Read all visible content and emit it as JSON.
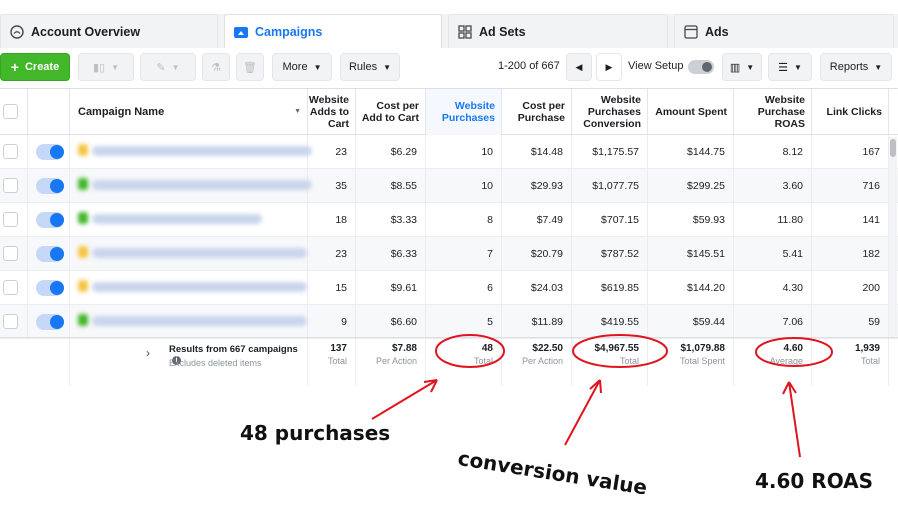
{
  "tabs": [
    {
      "label": "Account Overview",
      "icon": "gauge-icon"
    },
    {
      "label": "Campaigns",
      "icon": "folder-icon"
    },
    {
      "label": "Ad Sets",
      "icon": "grid-icon"
    },
    {
      "label": "Ads",
      "icon": "ad-icon"
    }
  ],
  "toolbar": {
    "create_label": "Create",
    "more_label": "More",
    "rules_label": "Rules",
    "pager_text": "1-200 of 667",
    "view_setup_label": "View Setup",
    "reports_label": "Reports"
  },
  "table": {
    "columns": [
      "Campaign Name",
      "Website Adds to Cart",
      "Cost per Add to Cart",
      "Website Purchases",
      "Cost per Purchase",
      "Website Purchases Conversion",
      "Amount Spent",
      "Website Purchase ROAS",
      "Link Clicks"
    ],
    "rows": [
      [
        "23",
        "$6.29",
        "10",
        "$14.48",
        "$1,175.57",
        "$144.75",
        "8.12",
        "167"
      ],
      [
        "35",
        "$8.55",
        "10",
        "$29.93",
        "$1,077.75",
        "$299.25",
        "3.60",
        "716"
      ],
      [
        "18",
        "$3.33",
        "8",
        "$7.49",
        "$707.15",
        "$59.93",
        "11.80",
        "141"
      ],
      [
        "23",
        "$6.33",
        "7",
        "$20.79",
        "$787.52",
        "$145.51",
        "5.41",
        "182"
      ],
      [
        "15",
        "$9.61",
        "6",
        "$24.03",
        "$619.85",
        "$144.20",
        "4.30",
        "200"
      ],
      [
        "9",
        "$6.60",
        "5",
        "$11.89",
        "$419.55",
        "$59.44",
        "7.06",
        "59"
      ]
    ],
    "totals": {
      "title": "Results from 667 campaigns",
      "subtitle": "Excludes deleted items",
      "cells": [
        {
          "value": "137",
          "label": "Total"
        },
        {
          "value": "$7.88",
          "label": "Per Action"
        },
        {
          "value": "48",
          "label": "Total"
        },
        {
          "value": "$22.50",
          "label": "Per Action"
        },
        {
          "value": "$4,967.55",
          "label": "Total"
        },
        {
          "value": "$1,079.88",
          "label": "Total Spent"
        },
        {
          "value": "4.60",
          "label": "Average"
        },
        {
          "value": "1,939",
          "label": "Total"
        }
      ]
    }
  },
  "annotations": {
    "purchases": "48 purchases",
    "conversion": "conversion value",
    "roas": "4.60 ROAS",
    "color": "#e0141e"
  }
}
